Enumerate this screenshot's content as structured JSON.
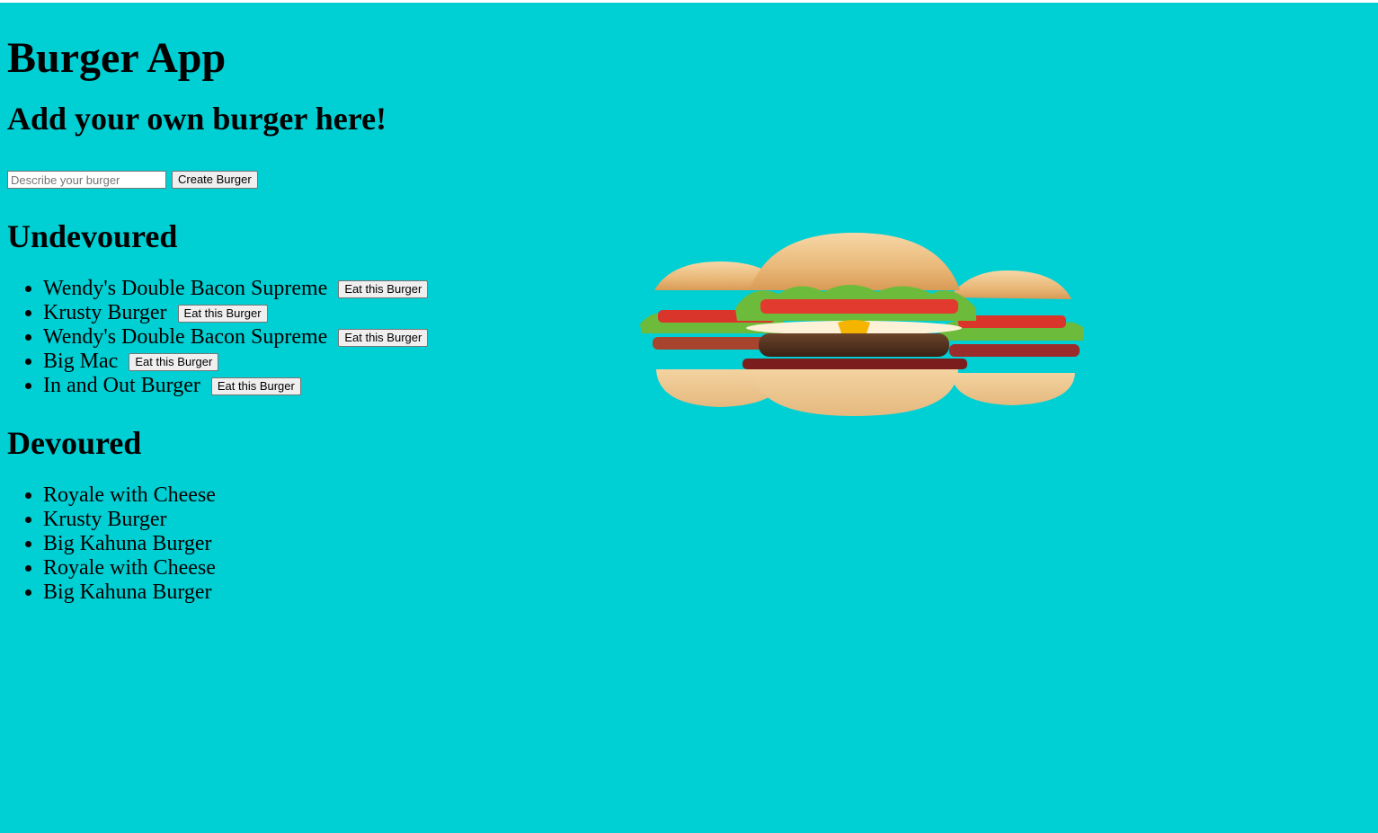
{
  "page": {
    "title": "Burger App",
    "background_color": "#00cfd4"
  },
  "add_section": {
    "heading": "Add your own burger here!",
    "input_placeholder": "Describe your burger",
    "input_value": "",
    "create_button_label": "Create Burger"
  },
  "undevoured": {
    "heading": "Undevoured",
    "items": [
      {
        "name": "Wendy's Double Bacon Supreme",
        "button_label": "Eat this Burger"
      },
      {
        "name": "Krusty Burger",
        "button_label": "Eat this Burger"
      },
      {
        "name": "Wendy's Double Bacon Supreme",
        "button_label": "Eat this Burger"
      },
      {
        "name": "Big Mac",
        "button_label": "Eat this Burger"
      },
      {
        "name": "In and Out Burger",
        "button_label": "Eat this Burger"
      }
    ]
  },
  "devoured": {
    "heading": "Devoured",
    "items": [
      {
        "name": "Royale with Cheese"
      },
      {
        "name": "Krusty Burger"
      },
      {
        "name": "Big Kahuna Burger"
      },
      {
        "name": "Royale with Cheese"
      },
      {
        "name": "Big Kahuna Burger"
      }
    ]
  },
  "image": {
    "subject": "three-burgers-image"
  }
}
